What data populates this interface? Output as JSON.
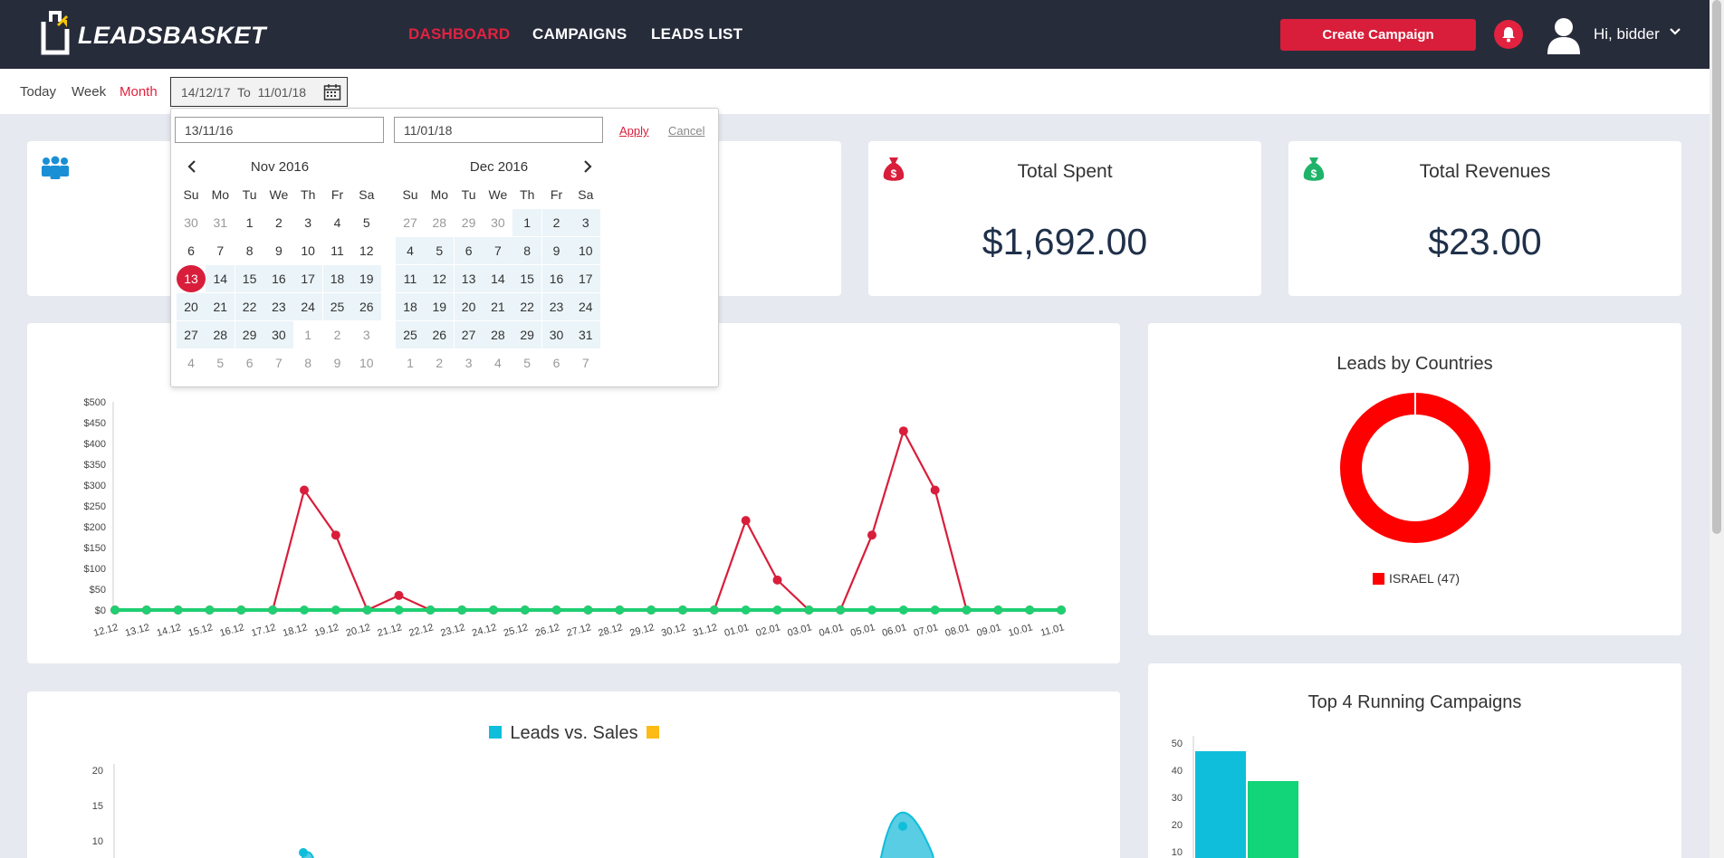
{
  "brand": {
    "logo_text": "LEADSBASKET"
  },
  "nav": {
    "links": [
      "DASHBOARD",
      "CAMPAIGNS",
      "LEADS LIST"
    ],
    "active": "DASHBOARD",
    "create_button": "Create Campaign",
    "user_greeting": "Hi, bidder"
  },
  "filter": {
    "today": "Today",
    "week": "Week",
    "month": "Month",
    "active": "Month",
    "range_text": "14/12/17  To  11/01/18"
  },
  "picker": {
    "start_value": "13/11/16",
    "end_value": "11/01/18",
    "apply": "Apply",
    "cancel": "Cancel",
    "weekdays": [
      "Su",
      "Mo",
      "Tu",
      "We",
      "Th",
      "Fr",
      "Sa"
    ],
    "left": {
      "title": "Nov 2016",
      "weeks": [
        [
          "30",
          "31",
          "1",
          "2",
          "3",
          "4",
          "5"
        ],
        [
          "6",
          "7",
          "8",
          "9",
          "10",
          "11",
          "12"
        ],
        [
          "13",
          "14",
          "15",
          "16",
          "17",
          "18",
          "19"
        ],
        [
          "20",
          "21",
          "22",
          "23",
          "24",
          "25",
          "26"
        ],
        [
          "27",
          "28",
          "29",
          "30",
          "1",
          "2",
          "3"
        ],
        [
          "4",
          "5",
          "6",
          "7",
          "8",
          "9",
          "10"
        ]
      ]
    },
    "right": {
      "title": "Dec 2016",
      "weeks": [
        [
          "27",
          "28",
          "29",
          "30",
          "1",
          "2",
          "3"
        ],
        [
          "4",
          "5",
          "6",
          "7",
          "8",
          "9",
          "10"
        ],
        [
          "11",
          "12",
          "13",
          "14",
          "15",
          "16",
          "17"
        ],
        [
          "18",
          "19",
          "20",
          "21",
          "22",
          "23",
          "24"
        ],
        [
          "25",
          "26",
          "27",
          "28",
          "29",
          "30",
          "31"
        ],
        [
          "1",
          "2",
          "3",
          "4",
          "5",
          "6",
          "7"
        ]
      ]
    }
  },
  "stats": {
    "spent_title": "Total Spent",
    "spent_value": "$1,692.00",
    "revenue_title": "Total Revenues",
    "revenue_value": "$23.00",
    "spent_color": "#d81e3a",
    "revenue_color": "#1fb36a"
  },
  "chart_data": [
    {
      "type": "line",
      "title": "",
      "categories": [
        "12.12",
        "13.12",
        "14.12",
        "15.12",
        "16.12",
        "17.12",
        "18.12",
        "19.12",
        "20.12",
        "21.12",
        "22.12",
        "23.12",
        "24.12",
        "25.12",
        "26.12",
        "27.12",
        "28.12",
        "29.12",
        "30.12",
        "31.12",
        "01.01",
        "02.01",
        "03.01",
        "04.01",
        "05.01",
        "06.01",
        "07.01",
        "08.01",
        "09.01",
        "10.01",
        "11.01"
      ],
      "ylim": [
        0,
        500
      ],
      "yticks": [
        "$0",
        "$50",
        "$100",
        "$150",
        "$200",
        "$250",
        "$300",
        "$350",
        "$400",
        "$450",
        "$500"
      ],
      "series": [
        {
          "color": "#d81e3a",
          "values": [
            0,
            0,
            0,
            0,
            0,
            0,
            288,
            180,
            0,
            35,
            0,
            0,
            0,
            0,
            0,
            0,
            0,
            0,
            0,
            0,
            215,
            72,
            0,
            0,
            180,
            430,
            288,
            0,
            0,
            0,
            0
          ]
        },
        {
          "color": "#1fcf72",
          "values": [
            0,
            0,
            0,
            0,
            0,
            0,
            0,
            0,
            0,
            0,
            0,
            0,
            0,
            0,
            0,
            0,
            0,
            0,
            0,
            0,
            0,
            0,
            0,
            0,
            0,
            0,
            0,
            0,
            0,
            0,
            0
          ]
        }
      ]
    },
    {
      "type": "pie",
      "title": "Leads by Countries",
      "slices": [
        {
          "label": "ISRAEL (47)",
          "value": 47,
          "color": "#ff0000"
        }
      ]
    },
    {
      "type": "area",
      "title": "Leads vs. Sales",
      "legend": [
        {
          "color": "#0fbedb"
        },
        {
          "color": "#fdbb16"
        }
      ],
      "yticks": [
        "20",
        "15",
        "10"
      ]
    },
    {
      "type": "bar",
      "title": "Top 4 Running Campaigns",
      "yticks": [
        "50",
        "40",
        "30",
        "20",
        "10"
      ],
      "series": [
        {
          "color": "#0fbedb",
          "values": [
            47
          ]
        },
        {
          "color": "#12d478",
          "values": [
            36
          ]
        }
      ]
    }
  ]
}
